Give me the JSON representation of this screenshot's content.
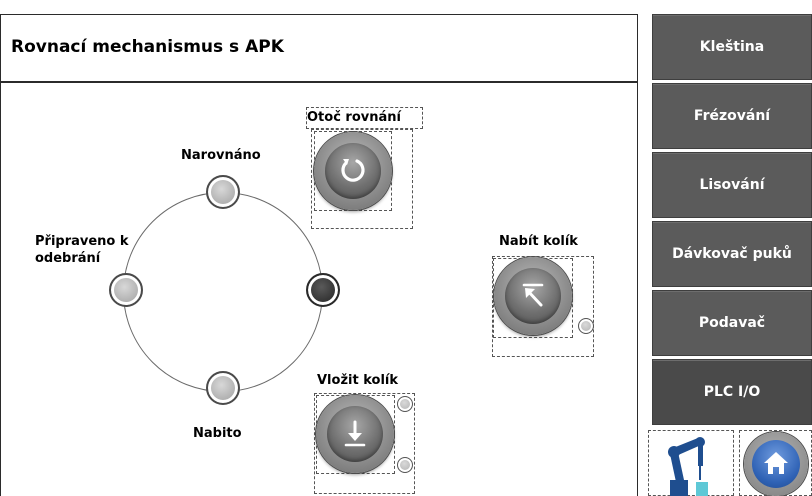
{
  "header": {
    "title": "Rovnací mechanismus s APK"
  },
  "ring": {
    "positions": [
      {
        "label": "Narovnáno",
        "state": "off"
      },
      {
        "label": "Připraveno k odebrání",
        "label_line1": "Připraveno k",
        "label_line2": "odebrání",
        "state": "off"
      },
      {
        "label": "",
        "state": "on"
      },
      {
        "label": "Nabito",
        "state": "off"
      }
    ]
  },
  "actions": {
    "rotate": {
      "label": "Otoč rovnání",
      "icon": "rotate-icon"
    },
    "load_pin": {
      "label": "Nabít kolík",
      "icon": "arrow-up-left-icon"
    },
    "insert_pin": {
      "label": "Vložit kolík",
      "icon": "insert-down-icon"
    }
  },
  "nav": {
    "items": [
      {
        "label": "Kleština"
      },
      {
        "label": "Frézování"
      },
      {
        "label": "Lisování"
      },
      {
        "label": "Dávkovač puků"
      },
      {
        "label": "Podavač"
      },
      {
        "label": "PLC I/O"
      }
    ]
  },
  "colors": {
    "nav_bg": "#5b5b5b",
    "nav_text": "#ffffff",
    "home_blue": "#2f62b5",
    "robot_blue": "#1f4e8f",
    "robot_cyan": "#5ec8d6",
    "indicator_on": "#333333",
    "indicator_off": "#b4b4b4"
  },
  "icons": {
    "robot": "robot-arm-icon",
    "home": "home-icon"
  }
}
